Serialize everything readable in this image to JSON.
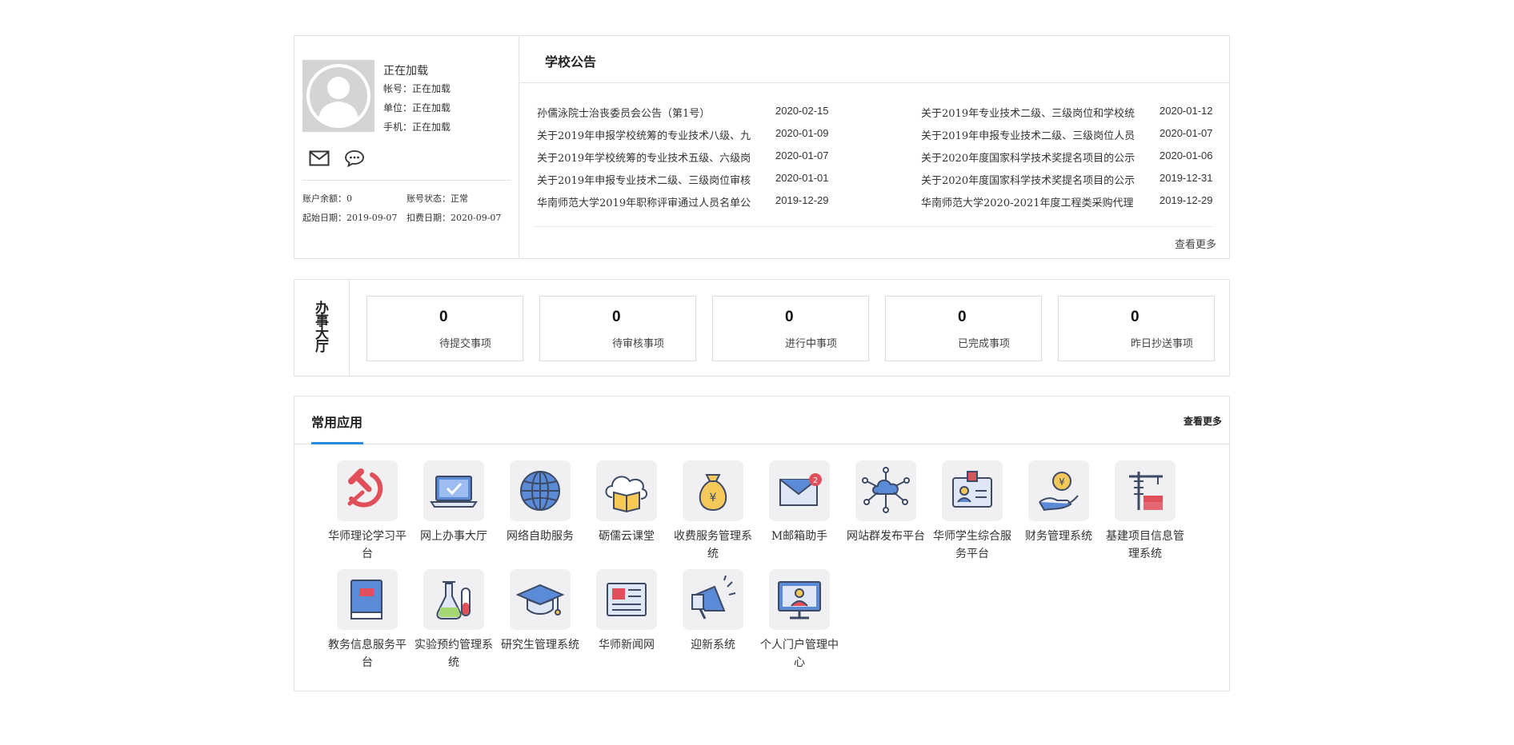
{
  "user": {
    "name": "正在加载",
    "account": "帐号：正在加载",
    "unit": "单位：正在加载",
    "phone": "手机：正在加载",
    "balance_label": "账户余额：",
    "balance_value": "0",
    "status_label": "账号状态：",
    "status_value": "正常",
    "start_label": "起始日期：",
    "start_value": "2019-09-07",
    "charge_label": "扣费日期：",
    "charge_value": "2020-09-07",
    "icons": [
      "mail-icon",
      "chat-icon"
    ]
  },
  "notices": {
    "title": "学校公告",
    "more": "查看更多",
    "items": [
      {
        "title": "孙儒泳院士治丧委员会公告（第1号）",
        "date": "2020-02-15"
      },
      {
        "title": "关于2019年专业技术二级、三级岗位和学校统",
        "date": "2020-01-12"
      },
      {
        "title": "关于2019年申报学校统筹的专业技术八级、九",
        "date": "2020-01-09"
      },
      {
        "title": "关于2019年申报专业技术二级、三级岗位人员",
        "date": "2020-01-07"
      },
      {
        "title": "关于2019年学校统筹的专业技术五级、六级岗",
        "date": "2020-01-07"
      },
      {
        "title": "关于2020年度国家科学技术奖提名项目的公示",
        "date": "2020-01-06"
      },
      {
        "title": "关于2019年申报专业技术二级、三级岗位审核",
        "date": "2020-01-01"
      },
      {
        "title": "关于2020年度国家科学技术奖提名项目的公示",
        "date": "2019-12-31"
      },
      {
        "title": "华南师范大学2019年职称评审通过人员名单公",
        "date": "2019-12-29"
      },
      {
        "title": "华南师范大学2020-2021年度工程类采购代理",
        "date": "2019-12-29"
      }
    ]
  },
  "hall": {
    "label": "办事大厅",
    "stats": [
      {
        "value": "0",
        "label": "待提交事项"
      },
      {
        "value": "0",
        "label": "待审核事项"
      },
      {
        "value": "0",
        "label": "进行中事项"
      },
      {
        "value": "0",
        "label": "已完成事项"
      },
      {
        "value": "0",
        "label": "昨日抄送事项"
      }
    ]
  },
  "apps": {
    "title": "常用应用",
    "more": "查看更多",
    "items": [
      {
        "label": "华师理论学习平台",
        "icon": "hammer-sickle-icon"
      },
      {
        "label": "网上办事大厅",
        "icon": "laptop-check-icon"
      },
      {
        "label": "网络自助服务",
        "icon": "globe-icon"
      },
      {
        "label": "砺儒云课堂",
        "icon": "cloud-book-icon"
      },
      {
        "label": "收费服务管理系统",
        "icon": "money-bag-icon"
      },
      {
        "label": "M邮箱助手",
        "icon": "mail-badge-icon",
        "badge": "2"
      },
      {
        "label": "网站群发布平台",
        "icon": "network-cloud-icon"
      },
      {
        "label": "华师学生综合服务平台",
        "icon": "id-card-icon"
      },
      {
        "label": "财务管理系统",
        "icon": "hand-coin-icon"
      },
      {
        "label": "基建项目信息管理系统",
        "icon": "crane-icon"
      },
      {
        "label": "教务信息服务平台",
        "icon": "book-icon"
      },
      {
        "label": "实验预约管理系统",
        "icon": "flask-icon"
      },
      {
        "label": "研究生管理系统",
        "icon": "graduation-cap-icon"
      },
      {
        "label": "华师新闻网",
        "icon": "newspaper-icon"
      },
      {
        "label": "迎新系统",
        "icon": "megaphone-icon"
      },
      {
        "label": "个人门户管理中心",
        "icon": "monitor-user-icon"
      }
    ]
  },
  "colors": {
    "accent": "#2a8ae0",
    "icon_blue": "#5b8ad6",
    "icon_red": "#e0505a",
    "icon_yellow": "#f5c85a",
    "icon_outline": "#3d4a66",
    "border": "#e2e2e2"
  }
}
